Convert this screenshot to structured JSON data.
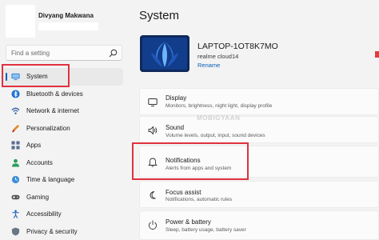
{
  "user": {
    "name": "Divyang Makwana"
  },
  "search": {
    "placeholder": "Find a setting"
  },
  "sidebar": {
    "items": [
      {
        "label": "System",
        "icon": "monitor-icon",
        "active": true
      },
      {
        "label": "Bluetooth & devices",
        "icon": "bluetooth-icon"
      },
      {
        "label": "Network & internet",
        "icon": "wifi-icon"
      },
      {
        "label": "Personalization",
        "icon": "brush-icon"
      },
      {
        "label": "Apps",
        "icon": "apps-icon"
      },
      {
        "label": "Accounts",
        "icon": "person-icon"
      },
      {
        "label": "Time & language",
        "icon": "globe-clock-icon"
      },
      {
        "label": "Gaming",
        "icon": "gamepad-icon"
      },
      {
        "label": "Accessibility",
        "icon": "accessibility-icon"
      },
      {
        "label": "Privacy & security",
        "icon": "shield-icon"
      }
    ]
  },
  "main": {
    "title": "System",
    "device": {
      "name": "LAPTOP-1OT8K7MO",
      "model": "realme cloud14",
      "rename_label": "Rename"
    },
    "cards": [
      {
        "title": "Display",
        "subtitle": "Monitors, brightness, night light, display profile",
        "icon": "display-icon"
      },
      {
        "title": "Sound",
        "subtitle": "Volume levels, output, input, sound devices",
        "icon": "speaker-icon"
      },
      {
        "title": "Notifications",
        "subtitle": "Alerts from apps and system",
        "icon": "bell-icon"
      },
      {
        "title": "Focus assist",
        "subtitle": "Notifications, automatic rules",
        "icon": "moon-icon"
      },
      {
        "title": "Power & battery",
        "subtitle": "Sleep, battery usage, battery saver",
        "icon": "power-icon"
      }
    ]
  },
  "watermark": "MOBIGYAAN",
  "colors": {
    "accent": "#005fb8",
    "highlight": "#e0313f",
    "background": "#f3f3f3",
    "card": "#fbfbfb"
  }
}
